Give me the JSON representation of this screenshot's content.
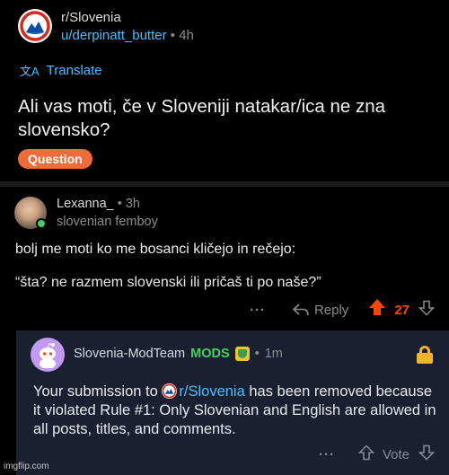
{
  "post": {
    "subreddit": "r/Slovenia",
    "author": "u/derpinatt_butter",
    "separator": "•",
    "age": "4h",
    "translate_label": "Translate",
    "title": "Ali vas moti, če v Sloveniji natakar/ica ne zna slovensko?",
    "flair": "Question"
  },
  "comment": {
    "username": "Lexanna_",
    "separator": "•",
    "age": "3h",
    "user_flair": "slovenian femboy",
    "body_line1": "bolj me moti ko me bosanci kličejo in rečejo:",
    "body_line2": "“šta? ne razmem slovenski ili pričaš ti po naše?”",
    "more": "···",
    "reply_label": "Reply",
    "score": "27"
  },
  "mod_reply": {
    "username": "Slovenia-ModTeam",
    "mods_badge": "MODS",
    "separator": "•",
    "age": "1m",
    "text_before": "Your submission to ",
    "subreddit_link": "r/Slovenia",
    "text_after": " has been removed because it violated Rule #1: Only Slovenian and English are allowed in all posts, titles, and comments.",
    "more": "···",
    "vote_label": "Vote"
  },
  "watermark": "imgflip.com",
  "colors": {
    "background": "#000000",
    "mod_background": "#1a2030",
    "link_blue": "#4fbcff",
    "upvote_orange": "#ff4500",
    "flair_orange": "#ee6b3b",
    "mods_green": "#46d160",
    "lock_yellow": "#f0b42d"
  },
  "icons": [
    "subreddit-avatar-icon",
    "translate-icon",
    "online-status-icon",
    "more-icon",
    "reply-icon",
    "upvote-icon",
    "downvote-icon",
    "snoo-avatar-icon",
    "mod-shield-icon",
    "lock-icon"
  ]
}
